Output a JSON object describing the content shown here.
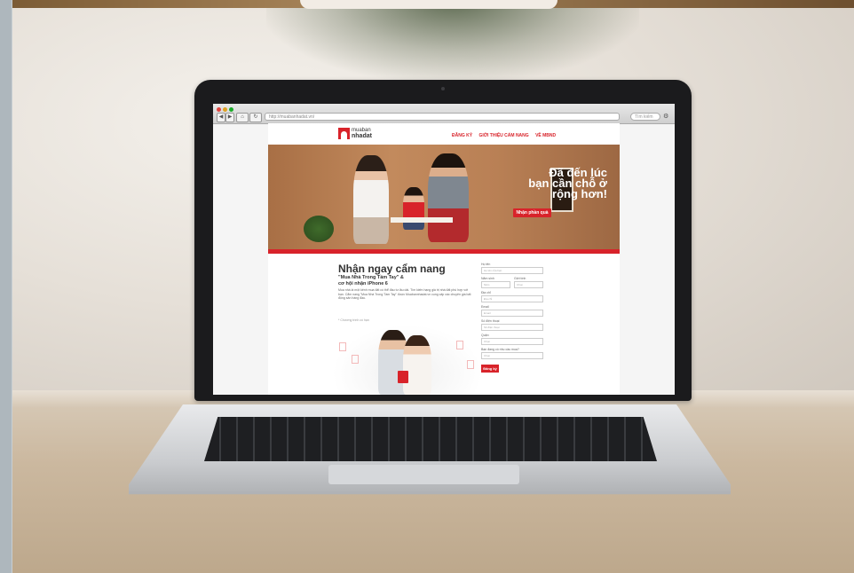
{
  "browser": {
    "url": "http://muabanhadat.vn/",
    "search_placeholder": "Tìm kiếm",
    "back_label": "◀",
    "forward_label": "▶"
  },
  "site": {
    "logo_line1": "muaban",
    "logo_line2": "nhadat",
    "menu": [
      "ĐĂNG KÝ",
      "GIỚI THIỆU CẨM NANG",
      "VỀ MBND"
    ]
  },
  "hero": {
    "title_line1": "Đã đến lúc",
    "title_line2": "bạn cần chỗ ở",
    "title_line3": "rộng hơn!",
    "button_label": "Nhận phần quà"
  },
  "content": {
    "heading": "Nhận ngay cẩm nang",
    "subheading": "\"Mua Nhà Trong Tầm Tay\" &",
    "subheading2": "cơ hội nhận iPhone 6",
    "paragraph": "Mua nhà là một kênh mua đất có thể đầu tư lâu dài. Tìm kiếm hạng giá trị nhà đất phù hợp với bạn. Cẩm nang \"Mua Nhà Trong Tầm Tay\" được Muabannhadat.vn cung cấp các chuyên gia bất động sản hàng đầu.",
    "note": "* Chương trình có hạn"
  },
  "form": {
    "fields": [
      {
        "label": "Họ tên",
        "placeholder": "Họ tên của bạn"
      },
      {
        "label": "Năm sinh",
        "placeholder": "Năm"
      },
      {
        "label": "Giới tính",
        "placeholder": "Chọn"
      },
      {
        "label": "Địa chỉ",
        "placeholder": "Địa chỉ"
      },
      {
        "label": "Email",
        "placeholder": "Email"
      },
      {
        "label": "Số điện thoại",
        "placeholder": "Số điện thoại"
      },
      {
        "label": "Quận",
        "placeholder": "Chọn"
      },
      {
        "label": "Bạn đang có nhu cầu mua?",
        "placeholder": "Chọn"
      }
    ],
    "submit_label": "Đăng ký"
  },
  "colors": {
    "brand_red": "#d8232a",
    "laptop_bezel": "#1b1b1d",
    "desk": "#cbb89f"
  }
}
